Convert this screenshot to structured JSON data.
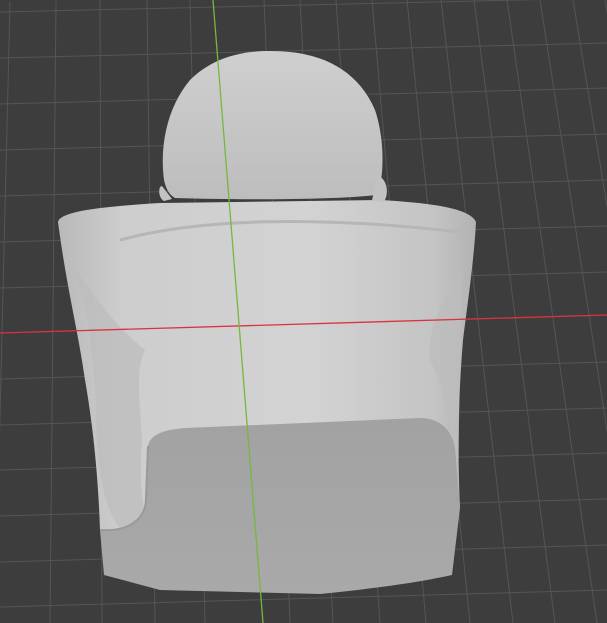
{
  "viewport": {
    "background_color": "#3d3d3d",
    "grid_color": "#555555",
    "x_axis_color": "#d9333f",
    "y_axis_color": "#76b83a",
    "model_color": "#c9c9c9",
    "model_shadow_color": "#9a9a9a",
    "model_base_color": "#a5a5a5"
  }
}
